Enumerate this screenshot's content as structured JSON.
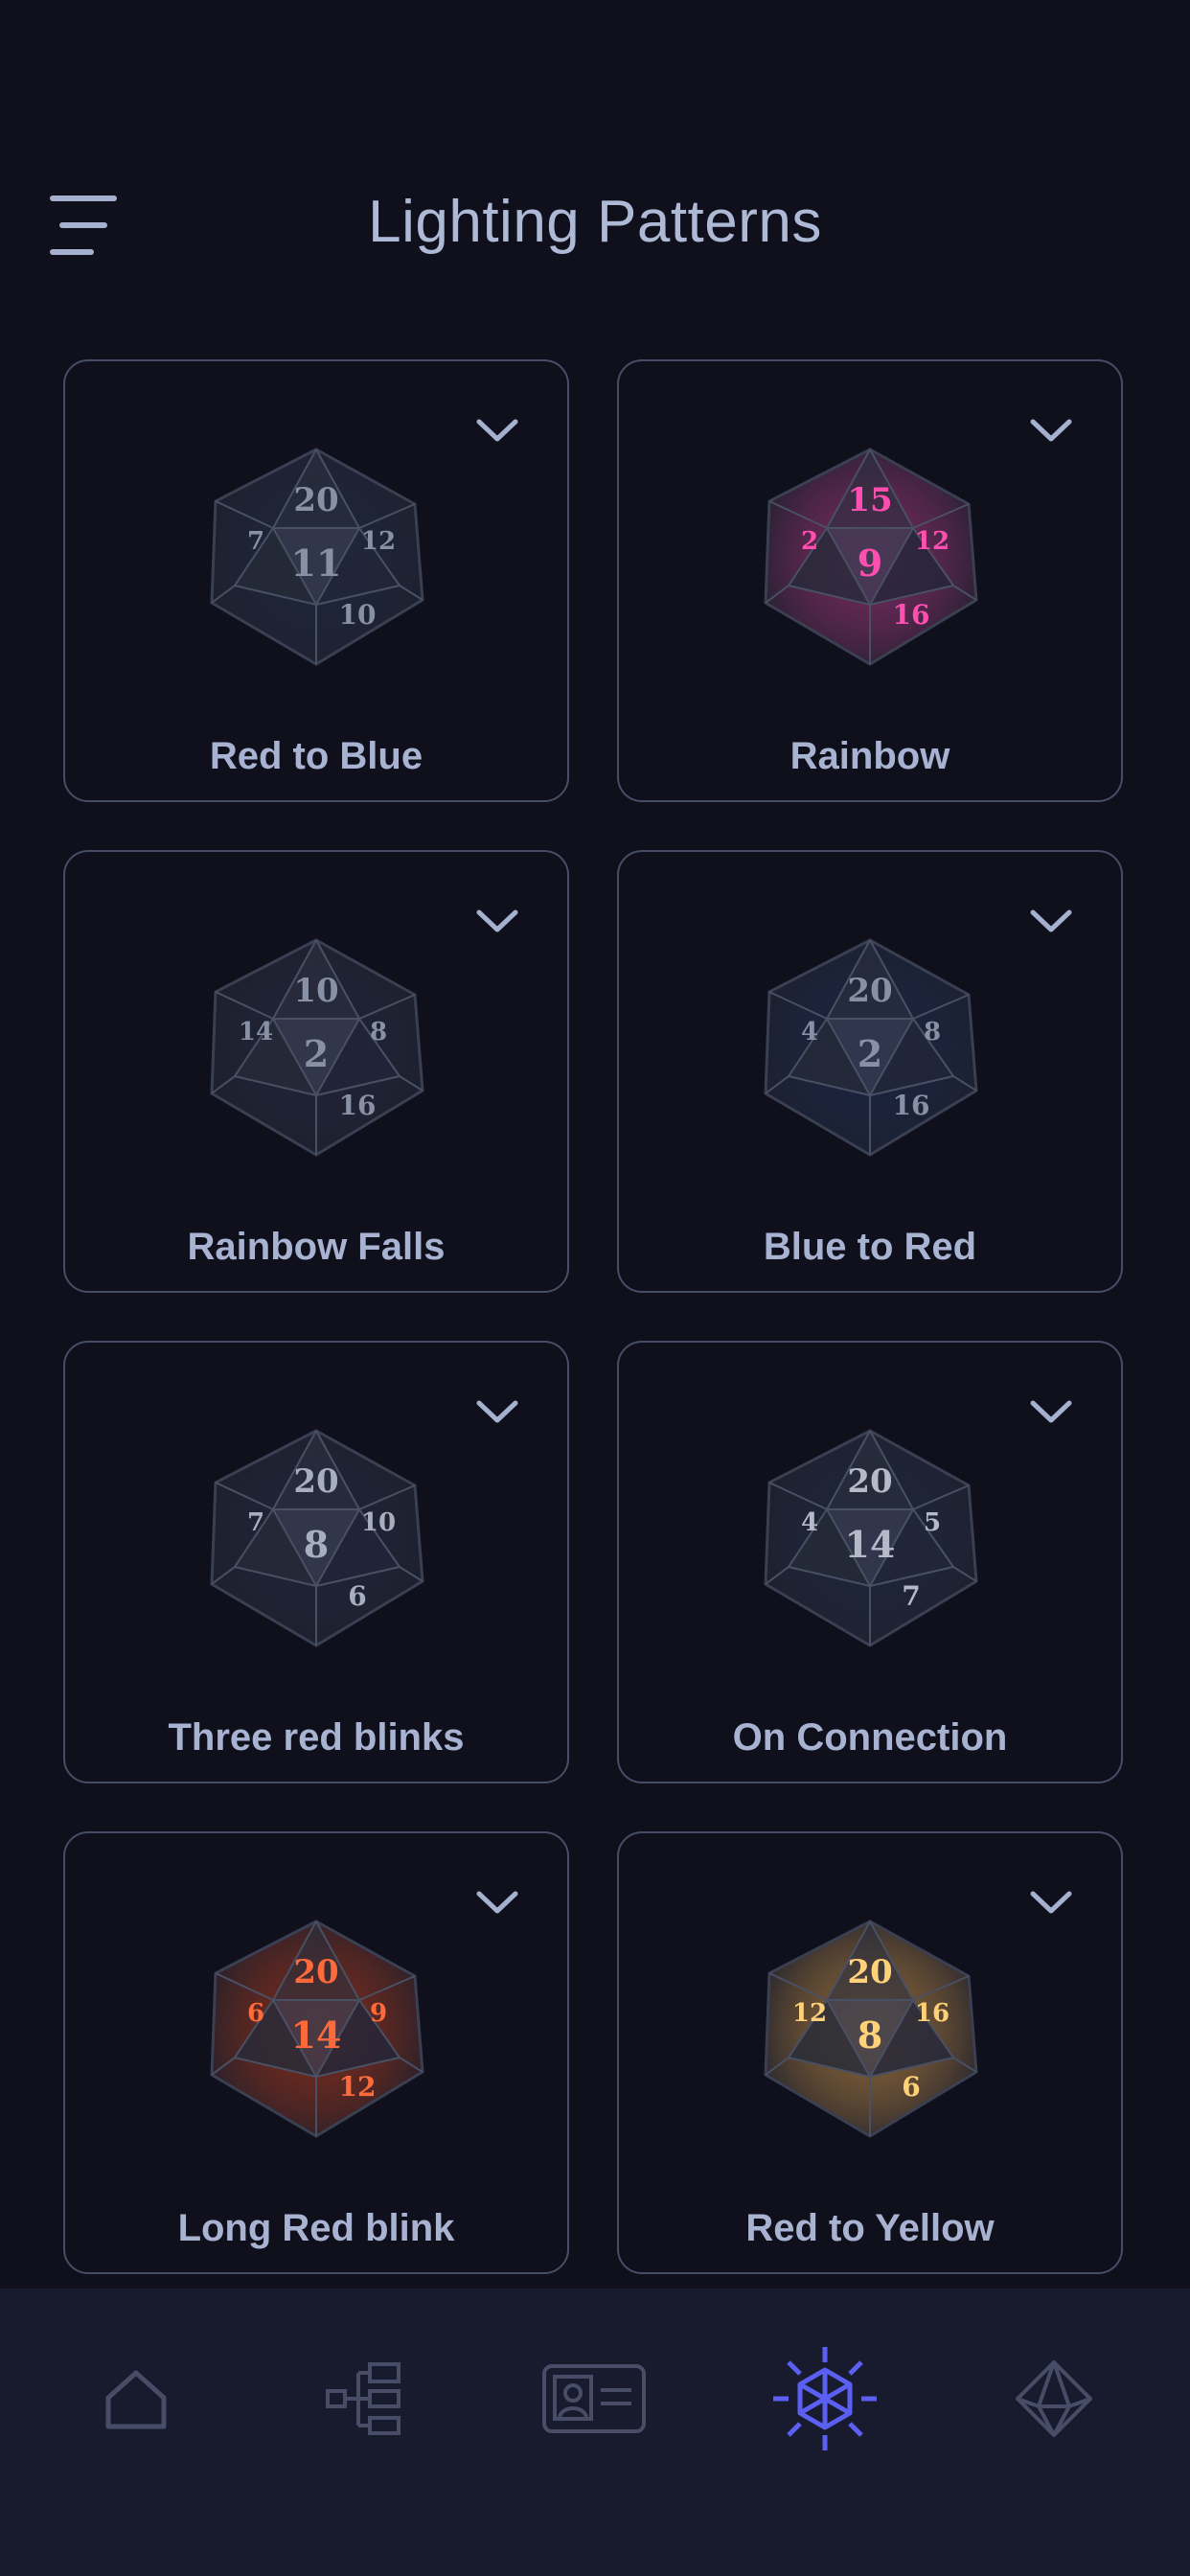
{
  "header": {
    "title": "Lighting Patterns",
    "menu_icon": "hamburger-menu-icon"
  },
  "patterns": [
    {
      "label": "Red to Blue",
      "n": [
        "20",
        "11",
        "7",
        "12",
        "10"
      ],
      "glow": "#2a3350",
      "text_color": "#8790a4"
    },
    {
      "label": "Rainbow",
      "n": [
        "15",
        "9",
        "2",
        "12",
        "16"
      ],
      "glow": "#b83a8a",
      "text_color": "#ff4fb0"
    },
    {
      "label": "Rainbow Falls",
      "n": [
        "10",
        "2",
        "14",
        "8",
        "16"
      ],
      "glow": "#2b3048",
      "text_color": "#8790a4"
    },
    {
      "label": "Blue to Red",
      "n": [
        "20",
        "2",
        "4",
        "8",
        "16"
      ],
      "glow": "#22315a",
      "text_color": "#8790a4"
    },
    {
      "label": "Three red blinks",
      "n": [
        "20",
        "8",
        "7",
        "10",
        "6"
      ],
      "glow": "#2b3048",
      "text_color": "#a7aebe"
    },
    {
      "label": "On Connection",
      "n": [
        "20",
        "14",
        "4",
        "5",
        "7"
      ],
      "glow": "#2a3350",
      "text_color": "#b4bac8"
    },
    {
      "label": "Long Red blink",
      "n": [
        "20",
        "14",
        "6",
        "9",
        "12"
      ],
      "glow": "#c23c1c",
      "text_color": "#ff6a3a"
    },
    {
      "label": "Red to Yellow",
      "n": [
        "20",
        "8",
        "12",
        "16",
        "6"
      ],
      "glow": "#d89a4a",
      "text_color": "#ffd27a"
    }
  ],
  "tabs": [
    {
      "name": "home-icon",
      "active": false
    },
    {
      "name": "hierarchy-icon",
      "active": false
    },
    {
      "name": "id-card-icon",
      "active": false
    },
    {
      "name": "d20-sun-icon",
      "active": true
    },
    {
      "name": "d20-outline-icon",
      "active": false
    }
  ],
  "colors": {
    "background": "#0f101c",
    "tabbar": "#181a2e",
    "accent": "#5b5ff2",
    "muted": "#474d66",
    "text": "#a8b3d2"
  }
}
